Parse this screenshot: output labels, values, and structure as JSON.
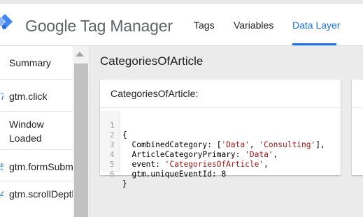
{
  "app": {
    "brand": "Google Tag Manager",
    "accent": "#1a73e8",
    "logo_colors": [
      "#4285f4",
      "#8ab4f8"
    ]
  },
  "nav": {
    "tabs": [
      {
        "label": "Tags",
        "active": false
      },
      {
        "label": "Variables",
        "active": false
      },
      {
        "label": "Data Layer",
        "active": true
      }
    ]
  },
  "sidebar": {
    "items": [
      {
        "num": "",
        "label": "Summary"
      },
      {
        "num": "7",
        "label": "gtm.click"
      },
      {
        "num": "",
        "label": "Window Loaded"
      },
      {
        "num": "5",
        "label": "gtm.formSubmit"
      },
      {
        "num": "4",
        "label": "gtm.scrollDepth"
      }
    ]
  },
  "main": {
    "title": "CategoriesOfArticle",
    "card_title": "CategoriesOfArticle:",
    "code_lines": [
      {
        "n": "1",
        "text": "{"
      },
      {
        "n": "2",
        "text": "  CombinedCategory: ['Data', 'Consulting'],"
      },
      {
        "n": "3",
        "text": "  ArticleCategoryPrimary: 'Data',"
      },
      {
        "n": "4",
        "text": "  event: 'CategoriesOfArticle',"
      },
      {
        "n": "5",
        "text": "  gtm.uniqueEventId: 8"
      },
      {
        "n": "6",
        "text": "}"
      }
    ]
  }
}
